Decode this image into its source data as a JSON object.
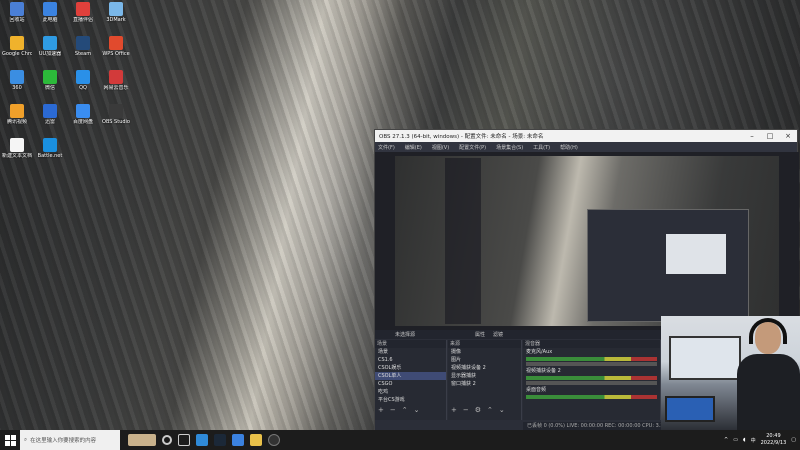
{
  "desktop_icons": [
    {
      "label": "回收站",
      "color": "#4a7fd6"
    },
    {
      "label": "此电脑",
      "color": "#3b83e0"
    },
    {
      "label": "直播伴侣",
      "color": "#e0403b"
    },
    {
      "label": "3DMark",
      "color": "#7ab7e8"
    },
    {
      "label": "Google Chrome",
      "color": "#f0b22c"
    },
    {
      "label": "UU加速器",
      "color": "#2f9be3"
    },
    {
      "label": "Steam",
      "color": "#244a79"
    },
    {
      "label": "WPS Office",
      "color": "#e14a2d"
    },
    {
      "label": "360",
      "color": "#3b8ee2"
    },
    {
      "label": "微信",
      "color": "#2cba3a"
    },
    {
      "label": "QQ",
      "color": "#2a90e8"
    },
    {
      "label": "网易云音乐",
      "color": "#d23a3a"
    },
    {
      "label": "腾讯视频",
      "color": "#f0a02a"
    },
    {
      "label": "迅雷",
      "color": "#2b6ad4"
    },
    {
      "label": "百度网盘",
      "color": "#3a8df0"
    },
    {
      "label": "OBS Studio",
      "color": "#3a3a3a"
    },
    {
      "label": "新建文本文档",
      "color": "#f5f5f5"
    },
    {
      "label": "Battle.net",
      "color": "#1a90e0"
    }
  ],
  "obs": {
    "title": "OBS 27.1.3 (64-bit, windows) - 配置文件: 未命名 - 场景: 未命名",
    "menu": [
      "文件(F)",
      "编辑(E)",
      "视图(V)",
      "配置文件(P)",
      "场景集合(S)",
      "工具(T)",
      "帮助(H)"
    ],
    "status_no_source": "未选择源",
    "btn_props": "属性",
    "btn_filters": "滤镜",
    "docks": {
      "scenes": {
        "title": "场景",
        "items": [
          "场景",
          "CS1.6",
          "CSOL娱乐",
          "CSOL单人",
          "CSGO",
          "吃鸡",
          "平台CS游戏"
        ]
      },
      "sources": {
        "title": "来源",
        "items": [
          "摄像",
          "图片",
          "视频捕获设备 2",
          "显示器捕获",
          "窗口捕获 2"
        ]
      },
      "mixer": {
        "title": "混音器",
        "tracks": [
          "麦克风/Aux",
          "视频捕获设备 2",
          "桌面音频"
        ]
      }
    },
    "statusbar": "已丢帧 0 (0.0%)   LIVE: 00:00:00   REC: 00:00:00   CPU: 3.3%, 60.00 fps   kb/s: 4250"
  },
  "taskbar": {
    "search_placeholder": "在这里输入你要搜索的内容",
    "time": "20:49",
    "date": "2022/9/13"
  }
}
